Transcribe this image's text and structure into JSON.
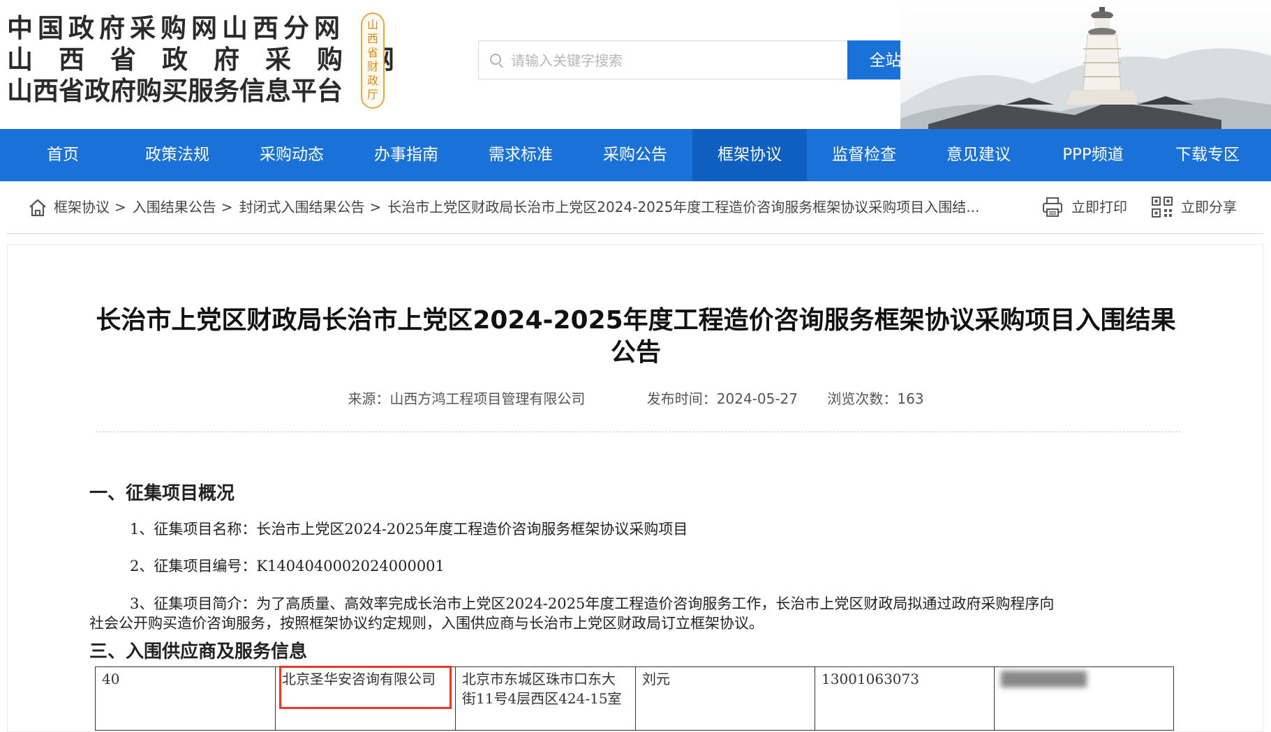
{
  "header": {
    "logo_lines": [
      "中国政府采购网山西分网",
      "山西省政府采购网",
      "山西省政府购买服务信息平台"
    ],
    "seal_chars": [
      "山",
      "西",
      "省",
      "财",
      "政",
      "厅"
    ],
    "search": {
      "placeholder": "请输入关键字搜索",
      "value": "",
      "button_label": "全站搜索"
    }
  },
  "nav": {
    "items": [
      "首页",
      "政策法规",
      "采购动态",
      "办事指南",
      "需求标准",
      "采购公告",
      "框架协议",
      "监督检查",
      "意见建议",
      "PPP频道",
      "下载专区"
    ],
    "active": "框架协议"
  },
  "breadcrumb": {
    "items": [
      "框架协议",
      "入围结果公告",
      "封闭式入围结果公告"
    ],
    "separator": ">",
    "current": "长治市上党区财政局长治市上党区2024-2025年度工程造价咨询服务框架协议采购项目入围结..."
  },
  "tools": {
    "print_label": "立即打印",
    "share_label": "立即分享"
  },
  "article": {
    "title": "长治市上党区财政局长治市上党区2024-2025年度工程造价咨询服务框架协议采购项目入围结果公告",
    "meta": {
      "source": "来源：山西方鸿工程项目管理有限公司",
      "publish_time": "发布时间：2024-05-27",
      "views": "浏览次数：163"
    },
    "section1_heading": "一、征集项目概况",
    "item1": "1、征集项目名称：长治市上党区2024-2025年度工程造价咨询服务框架协议采购项目",
    "item2": "2、征集项目编号：K1404040002024000001",
    "item3_line1": "3、征集项目简介：为了高质量、高效率完成长治市上党区2024-2025年度工程造价咨询服务工作，长治市上党区财政局拟通过政府采购程序向",
    "item3_line2": "社会公开购买造价咨询服务，按照框架协议约定规则，入围供应商与长治市上党区财政局订立框架协议。",
    "section3_heading": "三、入围供应商及服务信息",
    "table_rows": [
      {
        "no": "40",
        "company": "北京圣华安咨询有限公司",
        "address": "北京市东城区珠市口东大街11号4层西区424-15室",
        "contact": "刘元",
        "phone": "13001063073",
        "extra": "████████"
      }
    ]
  },
  "colors": {
    "primary": "#1a72d8",
    "nav_active": "#0f5fc0",
    "highlight": "#e23b2a",
    "seal": "#d48a1a"
  }
}
